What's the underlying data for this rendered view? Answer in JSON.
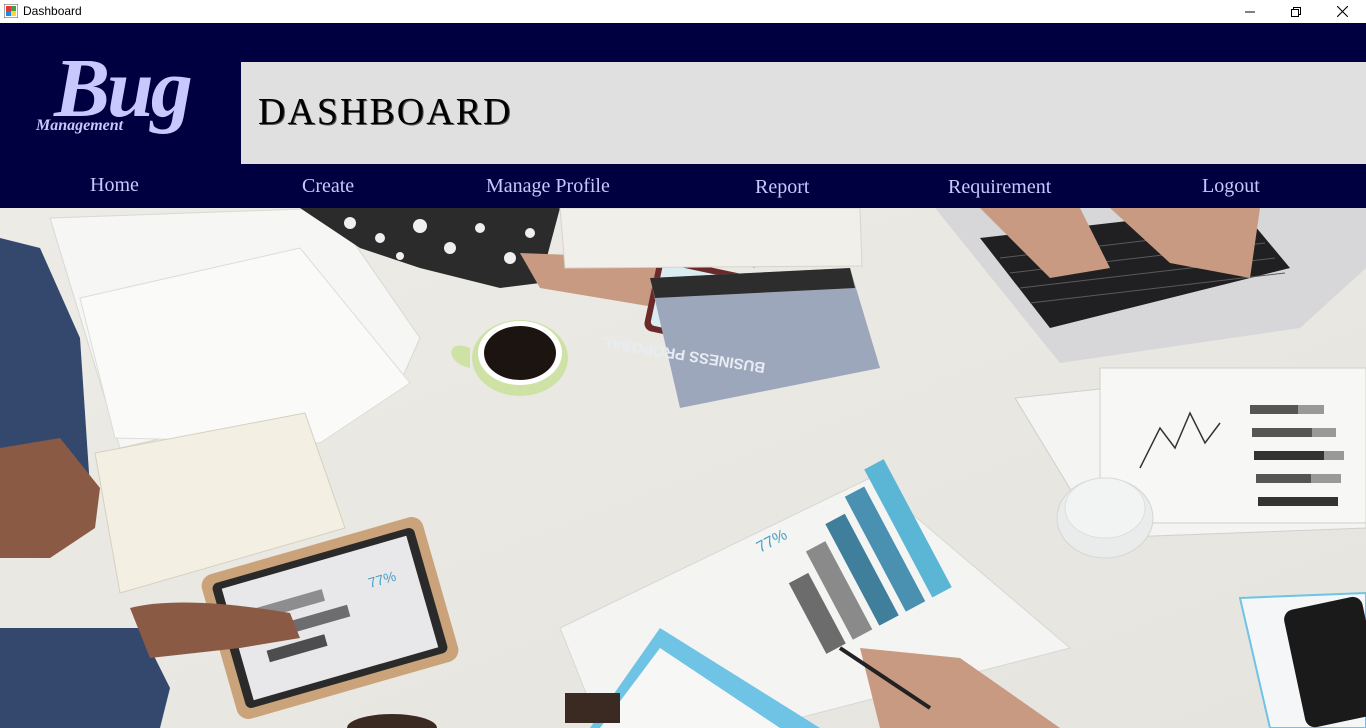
{
  "window": {
    "title": "Dashboard"
  },
  "logo": {
    "main": "Bug",
    "sub": "Management"
  },
  "header": {
    "title": "DASHBOARD"
  },
  "nav": {
    "home": "Home",
    "create": "Create",
    "manage_profile": "Manage Profile",
    "report": "Report",
    "requirement": "Requirement",
    "logout": "Logout"
  },
  "photo": {
    "booklet_text": "BUSINESS PROPOSAL",
    "chart_percent_1": "77%",
    "chart_percent_2": "77%"
  },
  "colors": {
    "header_bg": "#000040",
    "nav_text": "#c8c8ff",
    "title_panel": "#e0e0e0"
  }
}
